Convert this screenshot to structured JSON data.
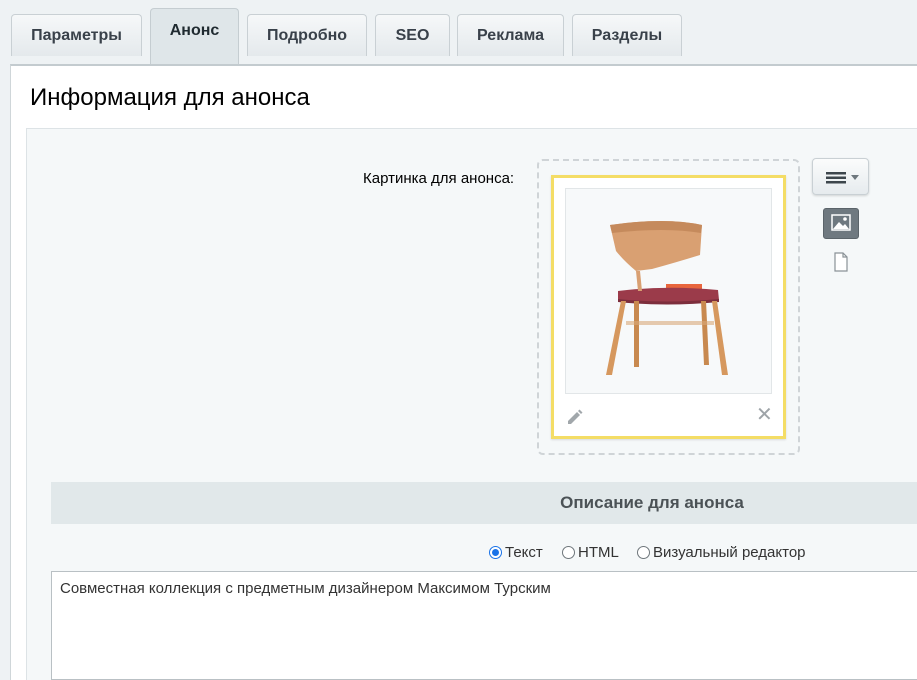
{
  "tabs": [
    {
      "label": "Параметры"
    },
    {
      "label": "Анонс",
      "active": true
    },
    {
      "label": "Подробно"
    },
    {
      "label": "SEO"
    },
    {
      "label": "Реклама"
    },
    {
      "label": "Разделы"
    }
  ],
  "section": {
    "title": "Информация для анонса"
  },
  "preview_picture": {
    "label": "Картинка для анонса:",
    "image": "chair-photo",
    "edit_icon": "pencil-icon",
    "delete_icon": "close-icon",
    "menu_icon": "hamburger-menu-icon",
    "mode_image_icon": "image-icon",
    "mode_file_icon": "file-icon"
  },
  "preview_text": {
    "title": "Описание для анонса",
    "modes": [
      {
        "label": "Текст",
        "checked": true
      },
      {
        "label": "HTML",
        "checked": false
      },
      {
        "label": "Визуальный редактор",
        "checked": false
      }
    ],
    "value": "Совместная коллекция с предметным дизайнером Максимом Турским"
  },
  "colors": {
    "accent": "#f4dd66",
    "radio_checked": "#1a73e8"
  }
}
